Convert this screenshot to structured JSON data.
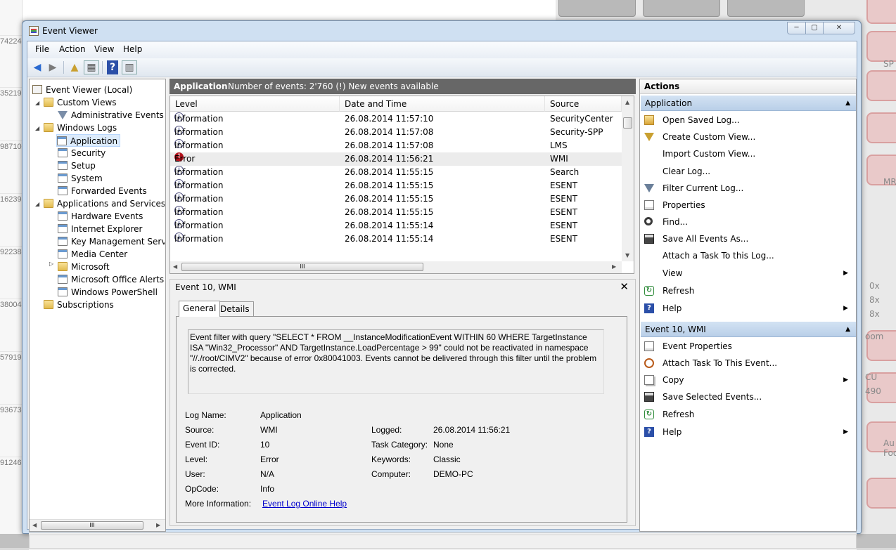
{
  "background": {
    "left_numbers": [
      "74224",
      "35219",
      "98710",
      "16239",
      "92238",
      "38004",
      "57919",
      "93673",
      "91246"
    ],
    "right_fragments": [
      "0x",
      "8x",
      "8x",
      "oom",
      "CU",
      "490",
      "Au",
      "Foo",
      "SP",
      "MR"
    ]
  },
  "window": {
    "title": "Event Viewer",
    "controls": {
      "minimize": "─",
      "maximize": "▢",
      "close": "✕"
    }
  },
  "menu": {
    "file": "File",
    "action": "Action",
    "view": "View",
    "help": "Help"
  },
  "toolbar": {
    "back": "◀",
    "forward": "▶",
    "up": "▲",
    "show_hide": "▦",
    "help": "?",
    "action_pane": "▥"
  },
  "tree": {
    "root": "Event Viewer (Local)",
    "custom_views": "Custom Views",
    "administrative_events": "Administrative Events",
    "windows_logs": "Windows Logs",
    "application": "Application",
    "security": "Security",
    "setup": "Setup",
    "system": "System",
    "forwarded_events": "Forwarded Events",
    "apps_services": "Applications and Services Lo",
    "hardware_events": "Hardware Events",
    "internet_explorer": "Internet Explorer",
    "key_management": "Key Management Service",
    "media_center": "Media Center",
    "microsoft": "Microsoft",
    "office_alerts": "Microsoft Office Alerts",
    "powershell": "Windows PowerShell",
    "subscriptions": "Subscriptions",
    "scroll_thumb": "III",
    "expanded_glyph": "◢",
    "collapsed_glyph": "▷"
  },
  "center": {
    "log_name": "Application",
    "event_count": "Number of events: 2'760 (!) New events available",
    "columns": {
      "level": "Level",
      "date_time": "Date and Time",
      "source": "Source"
    },
    "rows": [
      {
        "level": "Information",
        "date": "26.08.2014 11:57:10",
        "source": "SecurityCenter"
      },
      {
        "level": "Information",
        "date": "26.08.2014 11:57:08",
        "source": "Security-SPP"
      },
      {
        "level": "Information",
        "date": "26.08.2014 11:57:08",
        "source": "LMS"
      },
      {
        "level": "Error",
        "date": "26.08.2014 11:56:21",
        "source": "WMI"
      },
      {
        "level": "Information",
        "date": "26.08.2014 11:55:15",
        "source": "Search"
      },
      {
        "level": "Information",
        "date": "26.08.2014 11:55:15",
        "source": "ESENT"
      },
      {
        "level": "Information",
        "date": "26.08.2014 11:55:15",
        "source": "ESENT"
      },
      {
        "level": "Information",
        "date": "26.08.2014 11:55:15",
        "source": "ESENT"
      },
      {
        "level": "Information",
        "date": "26.08.2014 11:55:14",
        "source": "ESENT"
      },
      {
        "level": "Information",
        "date": "26.08.2014 11:55:14",
        "source": "ESENT"
      }
    ],
    "info_glyph": "i",
    "error_glyph": "!",
    "scroll_thumb": "III"
  },
  "detail": {
    "title": "Event 10, WMI",
    "close": "✕",
    "tabs": {
      "general": "General",
      "details": "Details"
    },
    "message": "Event filter with query \"SELECT * FROM __InstanceModificationEvent WITHIN 60 WHERE TargetInstance ISA \"Win32_Processor\" AND TargetInstance.LoadPercentage > 99\" could not be reactivated in namespace \"//./root/CIMV2\" because of error 0x80041003. Events cannot be delivered through this filter until the problem is corrected.",
    "labels": {
      "log_name": "Log Name:",
      "source": "Source:",
      "event_id": "Event ID:",
      "level": "Level:",
      "user": "User:",
      "opcode": "OpCode:",
      "more_info": "More Information:",
      "logged": "Logged:",
      "task_category": "Task Category:",
      "keywords": "Keywords:",
      "computer": "Computer:"
    },
    "values": {
      "log_name": "Application",
      "source": "WMI",
      "event_id": "10",
      "level": "Error",
      "user": "N/A",
      "opcode": "Info",
      "more_info_link": "Event Log Online Help",
      "logged": "26.08.2014 11:56:21",
      "task_category": "None",
      "keywords": "Classic",
      "computer": "DEMO-PC"
    }
  },
  "actions": {
    "title": "Actions",
    "group_application": "Application",
    "group_event": "Event 10, WMI",
    "collapse_glyph": "▲",
    "submenu_glyph": "▶",
    "app_items": {
      "open_saved_log": "Open Saved Log...",
      "create_custom_view": "Create Custom View...",
      "import_custom_view": "Import Custom View...",
      "clear_log": "Clear Log...",
      "filter_current_log": "Filter Current Log...",
      "properties": "Properties",
      "find": "Find...",
      "save_all_events": "Save All Events As...",
      "attach_task_log": "Attach a Task To this Log...",
      "view": "View",
      "refresh": "Refresh",
      "help": "Help"
    },
    "event_items": {
      "event_properties": "Event Properties",
      "attach_task_event": "Attach Task To This Event...",
      "copy": "Copy",
      "save_selected": "Save Selected Events...",
      "refresh": "Refresh",
      "help": "Help"
    },
    "icon_glyphs": {
      "refresh": "↻",
      "help": "?"
    }
  }
}
